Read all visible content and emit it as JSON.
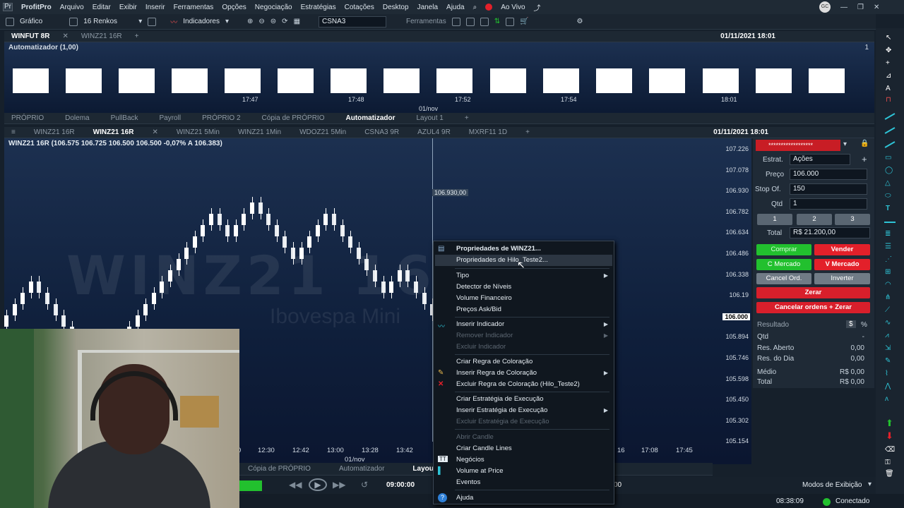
{
  "menu": {
    "app_name": "ProfitPro",
    "items": [
      "Arquivo",
      "Editar",
      "Exibir",
      "Inserir",
      "Ferramentas",
      "Opções",
      "Negociação",
      "Estratégias",
      "Cotações",
      "Desktop",
      "Janela",
      "Ajuda"
    ],
    "live": "Ao Vivo",
    "user": "GC"
  },
  "toolbar": {
    "chart_label": "Gráfico",
    "renko": "16 Renkos",
    "indicators": "Indicadores",
    "symbol": "CSNA3",
    "tools_label": "Ferramentas"
  },
  "top_window": {
    "tabs": [
      "WINFUT 8R",
      "WINZ21 16R"
    ],
    "datetime": "01/11/2021 18:01",
    "title": "Automatizador (1,00)",
    "time_labels": [
      "17:47",
      "17:48",
      "17:52",
      "17:54",
      "18:01"
    ],
    "date_label": "01/nov",
    "scale": "1"
  },
  "layout_tabs": [
    "PRÓPRIO",
    "Dolema",
    "PullBack",
    "Payroll",
    "PRÓPRIO 2",
    "Cópia de PRÓPRIO",
    "Automatizador",
    "Layout 1"
  ],
  "main_window": {
    "tabs": [
      "WINZ21 16R",
      "WINZ21 16R",
      "WINZ21 5Min",
      "WINZ21 1Min",
      "WDOZ21 5Min",
      "CSNA3 9R",
      "AZUL4 9R",
      "MXRF11 1D"
    ],
    "datetime": "01/11/2021 18:01",
    "header": "WINZ21 16R (106.575  106.725  106.500  106.500  -0,07%  A 106.383)",
    "watermark": "WINZ21 16R",
    "watermark_sub": "Ibovespa Mini",
    "crosshair_label": "106.930,00",
    "price_labels": [
      "107.226",
      "107.078",
      "106.930",
      "106.782",
      "106.634",
      "106.486",
      "106.338",
      "106.19",
      "106.04",
      "105.894",
      "105.746",
      "105.598",
      "105.450",
      "105.302",
      "105.154"
    ],
    "last_price": "106.000",
    "x_labels": [
      "12:30",
      "12:42",
      "13:00",
      "13:28",
      "13:42",
      "17:08",
      "17:45"
    ],
    "x_partial": [
      "0",
      "16"
    ],
    "date_label": "01/nov"
  },
  "chart_data": {
    "type": "bar",
    "title": "WINZ21 16R",
    "renko_close": [
      106.04,
      106.12,
      106.2,
      106.28,
      106.2,
      106.12,
      106.04,
      105.96,
      105.88,
      105.8,
      105.72,
      105.64,
      105.72,
      105.8,
      105.88,
      105.96,
      106.04,
      106.12,
      106.2,
      106.28,
      106.36,
      106.44,
      106.52,
      106.6,
      106.68,
      106.76,
      106.68,
      106.6,
      106.68,
      106.76,
      106.84,
      106.76,
      106.68,
      106.6,
      106.52,
      106.44,
      106.52,
      106.6,
      106.68,
      106.76,
      106.68,
      106.6,
      106.52,
      106.44,
      106.36,
      106.28,
      106.2,
      106.28,
      106.36,
      106.28,
      106.2,
      106.12,
      106.04,
      106.0
    ],
    "ylim": [
      105.154,
      107.226
    ]
  },
  "bottom_tabs": [
    "Cópia de PRÓPRIO",
    "Automatizador",
    "Layout"
  ],
  "replay_time": "09:00:00",
  "display_modes": "Modos de Exibição",
  "footer": {
    "clock": "08:38:09",
    "status": "Conectado"
  },
  "order_panel": {
    "account": "******************",
    "strat_label": "Estrat.",
    "strat_value": "Ações",
    "price_label": "Preço",
    "price_value": "106.000",
    "stop_label": "Stop Of.",
    "stop_value": "150",
    "qty_label": "Qtd",
    "qty_value": "1",
    "qty_buttons": [
      "1",
      "2",
      "3"
    ],
    "total_label": "Total",
    "total_value": "R$ 21.200,00",
    "buy": "Comprar",
    "sell": "Vender",
    "buy_market": "C Mercado",
    "sell_market": "V Mercado",
    "cancel": "Cancel Ord.",
    "invert": "Inverter",
    "zero": "Zerar",
    "cancel_zero": "Cancelar ordens + Zerar",
    "result_title": "Resultado",
    "currency": "$",
    "percent": "%",
    "rows": [
      {
        "label": "Qtd",
        "value": "-"
      },
      {
        "label": "Res. Aberto",
        "value": "0,00"
      },
      {
        "label": "Res. do Dia",
        "value": "0,00"
      },
      {
        "label": "Médio",
        "value": "R$ 0,00"
      },
      {
        "label": "Total",
        "value": "R$ 0,00"
      }
    ]
  },
  "context_menu": [
    {
      "label": "Propriedades de WINZ21...",
      "bold": true
    },
    {
      "label": "Propriedades de Hilo_Teste2..."
    },
    {
      "label": "Tipo",
      "sub": true
    },
    {
      "label": "Detector de Níveis"
    },
    {
      "label": "Volume Financeiro"
    },
    {
      "label": "Preços Ask/Bid"
    },
    {
      "label": "Inserir Indicador",
      "sub": true
    },
    {
      "label": "Remover Indicador",
      "sub": true,
      "disabled": true
    },
    {
      "label": "Excluir Indicador",
      "disabled": true
    },
    {
      "label": "Criar Regra de Coloração"
    },
    {
      "label": "Inserir Regra de Coloração",
      "sub": true
    },
    {
      "label": "Excluir Regra de Coloração (Hilo_Teste2)"
    },
    {
      "label": "Criar Estratégia de Execução"
    },
    {
      "label": "Inserir Estratégia de Execução",
      "sub": true
    },
    {
      "label": "Excluir Estratégia de Execução",
      "disabled": true
    },
    {
      "label": "Abrir Candle",
      "disabled": true
    },
    {
      "label": "Criar Candle Lines"
    },
    {
      "label": "Negócios"
    },
    {
      "label": "Volume at Price"
    },
    {
      "label": "Eventos"
    },
    {
      "label": "Ajuda"
    }
  ],
  "colors": {
    "buy": "#22c02e",
    "sell": "#e3202a",
    "accent": "#2ec4d6"
  }
}
